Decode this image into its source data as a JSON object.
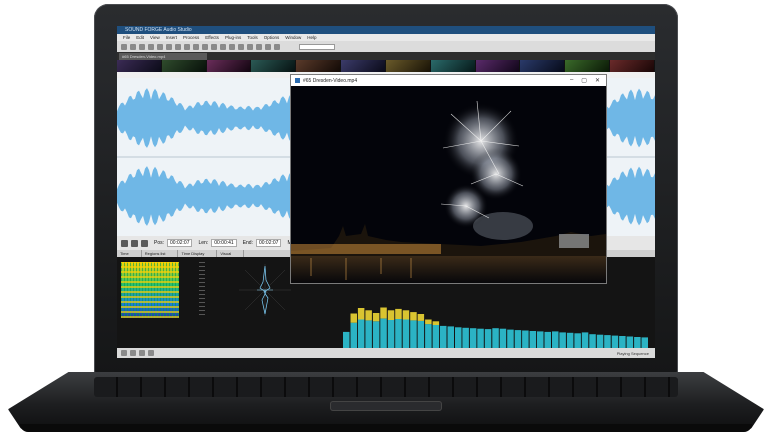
{
  "app": {
    "title": "SOUND FORGE Audio Studio",
    "menu": [
      "File",
      "Edit",
      "View",
      "Insert",
      "Process",
      "Effects",
      "Plug-ins",
      "Tools",
      "Options",
      "Window",
      "Help"
    ],
    "file_tab": "#65 Dresden-Video.mp4"
  },
  "transport": {
    "pos_label": "Pos:",
    "pos_value": "00:02:07",
    "len_label": "Len:",
    "len_value": "00:00:41",
    "end_label": "End:",
    "end_value": "00:02:07",
    "extra_label": "Mou"
  },
  "lower_panel": {
    "tabs": [
      "Time",
      "Regions list",
      "Time Display",
      "Visual"
    ]
  },
  "video_window": {
    "title": "#65 Dresden-Video.mp4",
    "minimize": "–",
    "maximize": "▢",
    "close": "✕"
  },
  "statusbar": {
    "right_text": "Playing Sequence"
  },
  "meter": {
    "levels": [
      0.35,
      0.55,
      0.62,
      0.6,
      0.58,
      0.64,
      0.61,
      0.63,
      0.62,
      0.6,
      0.59,
      0.52,
      0.5,
      0.48,
      0.47,
      0.45,
      0.44,
      0.43,
      0.42,
      0.41,
      0.43,
      0.42,
      0.4,
      0.39,
      0.38,
      0.37,
      0.36,
      0.35,
      0.36,
      0.34,
      0.33,
      0.32,
      0.34,
      0.3,
      0.29,
      0.28,
      0.27,
      0.26,
      0.25,
      0.24,
      0.23
    ],
    "peaks": [
      0.0,
      0.2,
      0.25,
      0.22,
      0.18,
      0.24,
      0.21,
      0.22,
      0.2,
      0.18,
      0.15,
      0.1,
      0.08,
      0.0,
      0.0,
      0.0,
      0.0,
      0.0,
      0.0,
      0.0,
      0.0,
      0.0,
      0.0,
      0.0,
      0.0,
      0.0,
      0.0,
      0.0,
      0.0,
      0.0,
      0.0,
      0.0,
      0.0,
      0.0,
      0.0,
      0.0,
      0.0,
      0.0,
      0.0,
      0.0,
      0.0
    ],
    "bar_color": "#2bb3c4",
    "peak_color": "#d9c431"
  },
  "colors": {
    "waveform": "#6fb7e6",
    "titlebar": "#1f4f7e"
  }
}
